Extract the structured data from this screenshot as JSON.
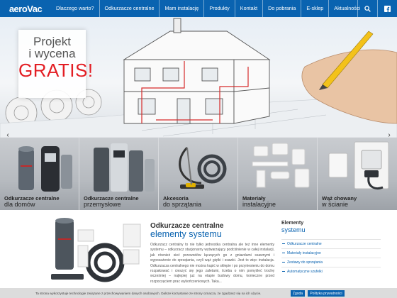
{
  "nav": {
    "logo": "aeroVac",
    "items": [
      {
        "label": "Dlaczego warto?"
      },
      {
        "label": "Odkurzacze centralne"
      },
      {
        "label": "Mam instalację"
      },
      {
        "label": "Produkty"
      },
      {
        "label": "Kontakt"
      },
      {
        "label": "Do pobrania"
      },
      {
        "label": "E-sklep"
      },
      {
        "label": "Aktualności"
      }
    ],
    "icons": [
      "search-icon",
      "facebook-icon"
    ]
  },
  "hero": {
    "promo_line1": "Projekt",
    "promo_line2": "i wycena",
    "promo_gratis": "GRATIS!"
  },
  "categories": [
    {
      "title": "Odkurzacze centralne",
      "subtitle": "dla domów"
    },
    {
      "title": "Odkurzacze centralne",
      "subtitle": "przemysłowe"
    },
    {
      "title": "Akcesoria",
      "subtitle": "do sprzątania"
    },
    {
      "title": "Materiały",
      "subtitle": "instalacyjne"
    },
    {
      "title": "Wąż chowany",
      "subtitle": "w ścianie"
    }
  ],
  "article": {
    "title_line1": "Odkurzacze centralne",
    "title_line2": "elementy systemu",
    "body": "Odkurzacz centralny to nie tylko jednostka centralna ale też inne elementy systemu – odkurzacz stacjonarny wytwarzający podciśnienie w całej instalacji, jak również sieć przewodów łączących go z gniazdami ssawnymi i wyposażenie do sprzątania, czyli wąż giętki i ssawki. Jest to więc instalacja. Odkurzacza centralnego nie można kupić w sklepie i po przyniesieniu do domu rozpakować i cieszyć się jego zaletami, trzeba o nim pomyśleć trochę wcześniej – najlepiej już na etapie budowy domu, konieczne przed rozpoczęciem prac wykończeniowych. Taka..."
  },
  "sidebar": {
    "title1": "Elementy",
    "title2": "systemu",
    "items": [
      {
        "label": "Odkurzacze centralne"
      },
      {
        "label": "Materiały instalacyjne"
      },
      {
        "label": "Zestawy do sprzątania"
      },
      {
        "label": "Automatyczne szufelki"
      }
    ]
  },
  "cookie": {
    "text": "Ta strona wykorzystuje technologie związane z przechowywaniem danych osobowych. Dalsze korzystanie ze strony oznacza, że zgadzasz się na ich użycie.",
    "accept_label": "Zgoda",
    "policy_label": "Polityka prywatności"
  },
  "colors": {
    "brand_blue": "#0a63b0",
    "accent_red": "#e31e24"
  }
}
